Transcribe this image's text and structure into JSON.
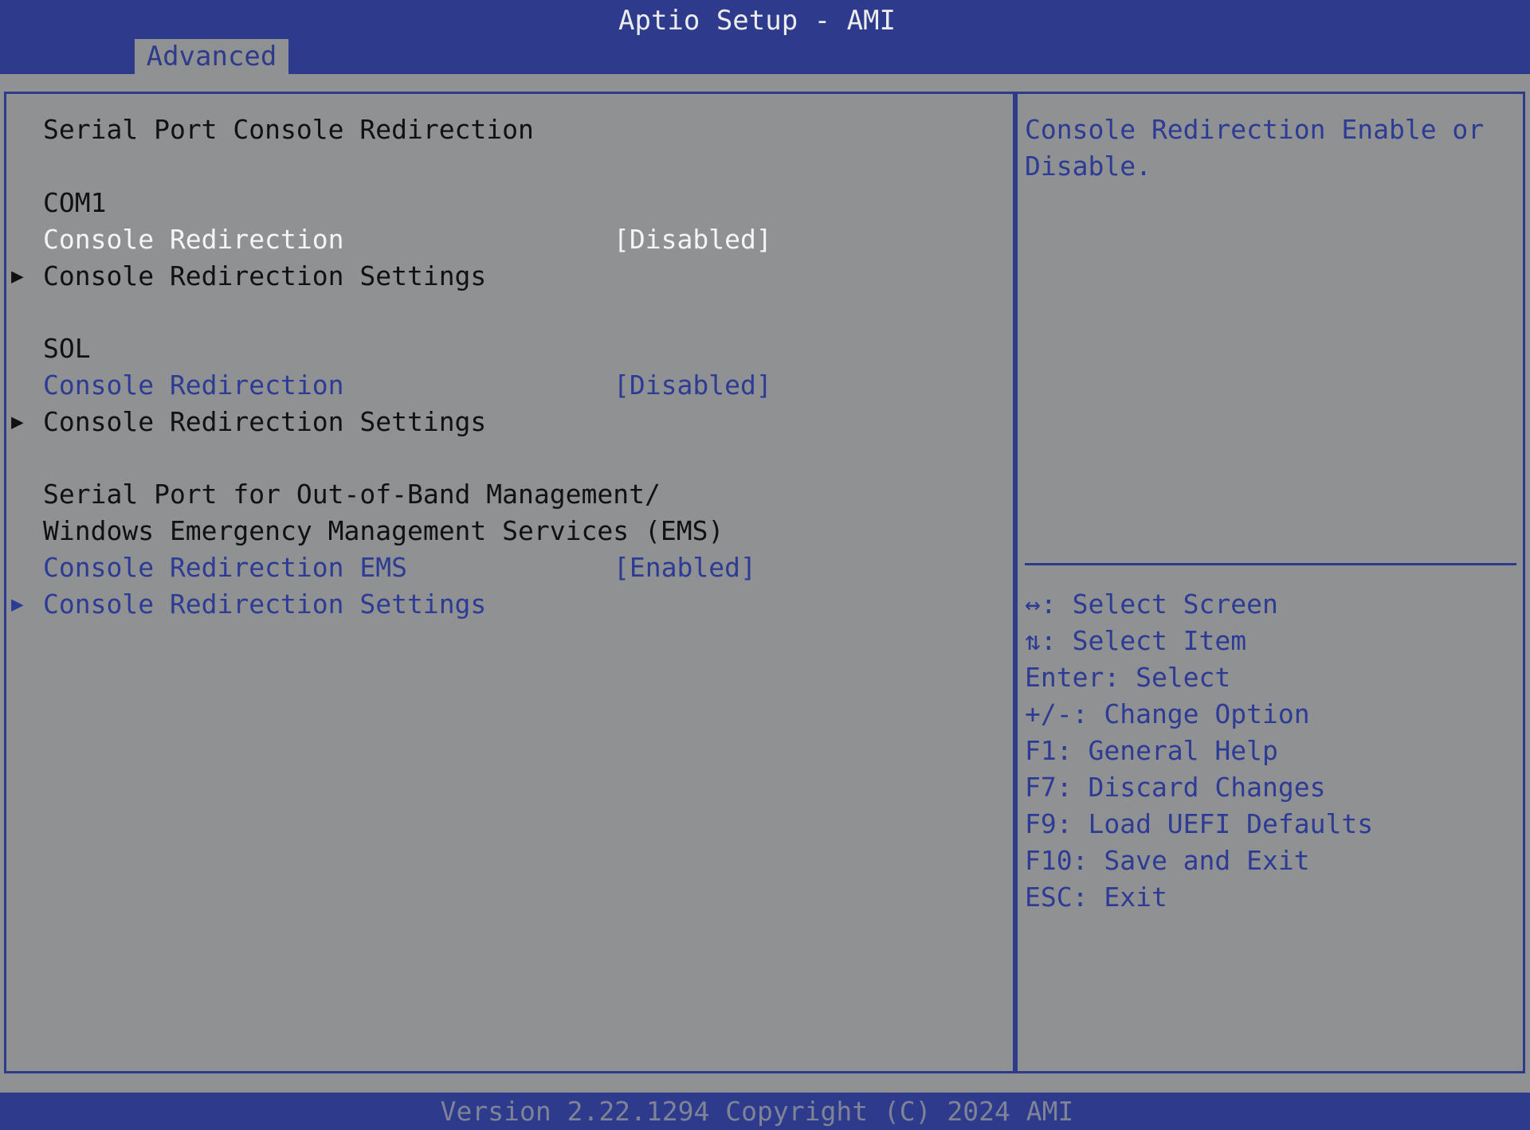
{
  "header": {
    "title": "Aptio Setup - AMI",
    "tabs": [
      {
        "label": "Advanced"
      }
    ]
  },
  "main": {
    "section_title": "Serial Port Console Redirection",
    "com1": {
      "label": "COM1",
      "console_redirection_label": "Console Redirection",
      "console_redirection_value": "[Disabled]",
      "settings_label": "Console Redirection Settings"
    },
    "sol": {
      "label": "SOL",
      "console_redirection_label": "Console Redirection",
      "console_redirection_value": "[Disabled]",
      "settings_label": "Console Redirection Settings"
    },
    "ems": {
      "heading_line1": "Serial Port for Out-of-Band Management/",
      "heading_line2": "Windows Emergency Management Services (EMS)",
      "console_redirection_label": "Console Redirection EMS",
      "console_redirection_value": "[Enabled]",
      "settings_label": "Console Redirection Settings"
    },
    "submenu_arrow": "▶"
  },
  "help": {
    "description_line1": "Console Redirection Enable or",
    "description_line2": "Disable.",
    "keys": [
      "↔: Select Screen",
      "⇅: Select Item",
      "Enter: Select",
      "+/-: Change Option",
      "F1: General Help",
      "F7: Discard Changes",
      "F9: Load UEFI Defaults",
      "F10: Save and Exit",
      "ESC: Exit"
    ]
  },
  "footer": {
    "version": "Version 2.22.1294 Copyright (C) 2024 AMI"
  },
  "colors": {
    "background": "#8f9192",
    "bar": "#2e3a8c",
    "highlight_text": "#f5f5f5",
    "selectable_text": "#2d3b95",
    "static_text": "#111111"
  }
}
